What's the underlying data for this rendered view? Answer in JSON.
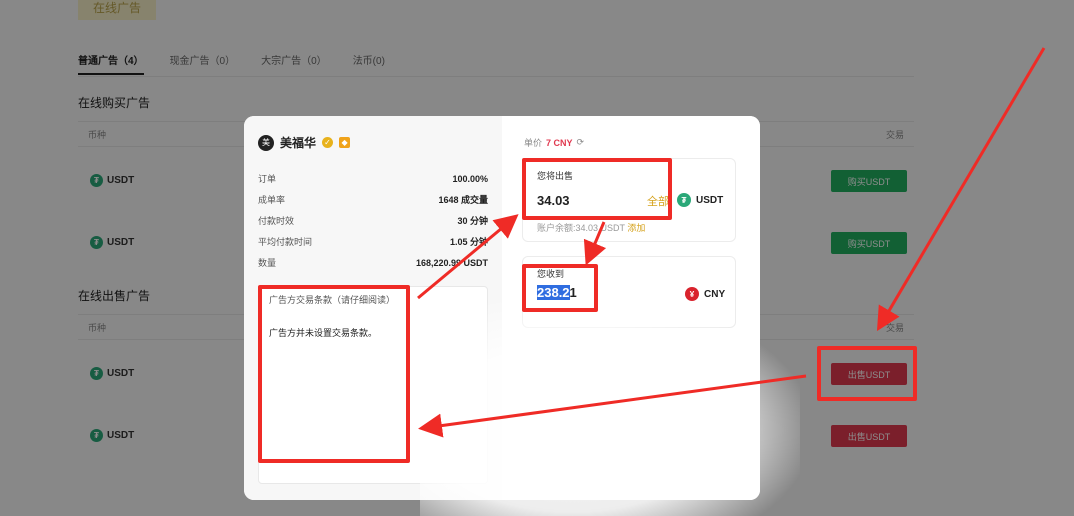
{
  "page": {
    "online_button": "在线广告",
    "tabs": [
      "普通广告（4）",
      "现金广告（0）",
      "大宗广告（0）",
      "法币(0)"
    ],
    "buy_section_title": "在线购买广告",
    "sell_section_title": "在线出售广告",
    "col_coin": "币种",
    "col_trade": "交易",
    "coin": "USDT",
    "buy_label": "购买USDT",
    "sell_label": "出售USDT"
  },
  "modal": {
    "merchant_name": "美福华",
    "stats": [
      {
        "label": "订单",
        "value": "100.00%"
      },
      {
        "label": "成单率",
        "value": "1648 成交量"
      },
      {
        "label": "付款时效",
        "value": "30 分钟"
      },
      {
        "label": "平均付款时间",
        "value": "1.05 分钟"
      },
      {
        "label": "数量",
        "value": "168,220.99 USDT"
      }
    ],
    "terms_title": "广告方交易条款（请仔细阅读）",
    "terms_body": "广告方并未设置交易条款。",
    "unit_price_label": "单价",
    "unit_price": "7 CNY",
    "sell_label": "您将出售",
    "sell_amount": "34.03",
    "all_label": "全部",
    "sell_currency": "USDT",
    "available_text": "账户余额:34.03 USDT",
    "add_label": "添加",
    "receive_label": "您收到",
    "receive_amount_selected": "238.2",
    "receive_amount_rest": "1",
    "receive_currency": "CNY"
  },
  "colors": {
    "annotation": "#ef2b26",
    "buy": "#21b060",
    "sell": "#e0394f",
    "accent": "#d5a21c"
  }
}
